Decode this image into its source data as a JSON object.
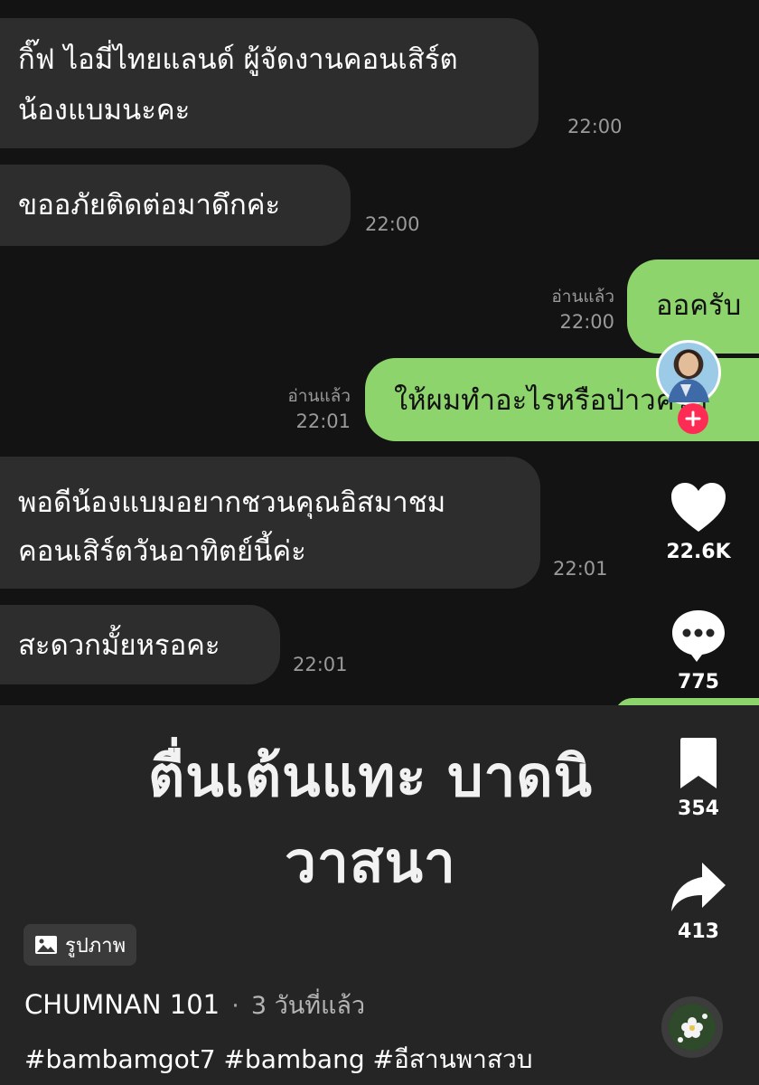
{
  "messages": [
    {
      "dir": "in",
      "lines": [
        "กิ๊ฟ ไอมี่ไทยแลนด์ ผู้จัดงานคอนเสิร์ต",
        "น้องแบมนะคะ"
      ],
      "time": "22:00"
    },
    {
      "dir": "in",
      "lines": [
        "ขออภัยติดต่อมาดึกค่ะ"
      ],
      "time": "22:00"
    },
    {
      "dir": "out",
      "lines": [
        "ออครับ"
      ],
      "read": "อ่านแล้ว",
      "time": "22:00"
    },
    {
      "dir": "out",
      "lines": [
        "ให้ผมทำอะไรหรือป่าวครับ"
      ],
      "read": "อ่านแล้ว",
      "time": "22:01"
    },
    {
      "dir": "in",
      "lines": [
        "พอดีน้องแบมอยากชวนคุณอิสมาชม",
        "คอนเสิร์ตวันอาทิตย์นี้ค่ะ"
      ],
      "time": "22:01"
    },
    {
      "dir": "in",
      "lines": [
        "สะดวกมั้ยหรอคะ"
      ],
      "time": "22:01"
    }
  ],
  "caption": {
    "line1": "ตื่นเต้นแทะ บาดนิ",
    "line2": "วาสนา"
  },
  "actions": {
    "likes": "22.6K",
    "comments": "775",
    "saves": "354",
    "shares": "413"
  },
  "post": {
    "type_label": "รูปภาพ",
    "author": "CHUMNAN 101",
    "separator": "·",
    "time_ago": "3 วันที่แล้ว",
    "hashtags": "#bambamgot7 #bambang #อีสานพาสวบ"
  },
  "icons": {
    "profile": "profile-avatar",
    "follow": "plus-icon",
    "like": "heart-icon",
    "comment": "comment-icon",
    "save": "bookmark-icon",
    "share": "share-icon",
    "photo": "photo-icon",
    "sound": "music-disc-icon"
  },
  "colors": {
    "outgoing_bubble": "#8ed46c",
    "incoming_bubble": "#2d2d2d",
    "follow_badge": "#fe2c55"
  }
}
